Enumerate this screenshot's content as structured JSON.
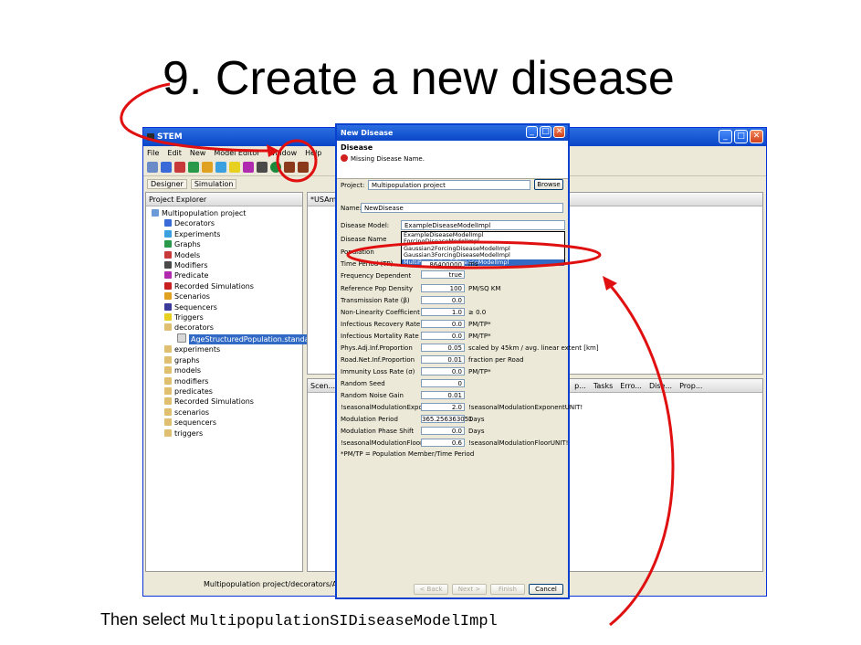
{
  "slide": {
    "title": "9. Create a new disease",
    "caption_prefix": "Then select ",
    "caption_code": "MultipopulationSIDiseaseModelImpl"
  },
  "stem_window": {
    "title": "STEM",
    "menu": [
      "File",
      "Edit",
      "New",
      "Model Editor",
      "Window",
      "Help"
    ],
    "perspectives": [
      "Designer",
      "Simulation"
    ],
    "project_explorer": {
      "title": "Project Explorer",
      "items": [
        "Multipopulation project",
        "Decorators",
        "Experiments",
        "Graphs",
        "Models",
        "Modifiers",
        "Predicate",
        "Recorded Simulations",
        "Scenarios",
        "Sequencers",
        "Triggers",
        "decorators",
        "AgeStructuredPopulation.standard",
        "experiments",
        "graphs",
        "models",
        "modifiers",
        "predicates",
        "Recorded Simulations",
        "scenarios",
        "sequencers",
        "triggers"
      ]
    },
    "editor_tab": "*USAm",
    "lower_panel_tab": "Scen...",
    "lower_tabs": [
      "p...",
      "Tasks",
      "Erro...",
      "Dise...",
      "Prop..."
    ],
    "status_text": "Multipopulation project/decorators/AgeStruct"
  },
  "dialog": {
    "title": "New Disease",
    "heading": "Disease",
    "message": "Missing Disease Name.",
    "project_label": "Project:",
    "project_value": "Multipopulation project",
    "browse": "Browse",
    "name_label": "Name:",
    "name_value": "NewDisease",
    "model_label": "Disease Model:",
    "model_value": "ExampleDiseaseModelImpl",
    "model_options": [
      "ExampleDiseaseModelImpl",
      "ForcingDiseaseModelImpl",
      "Gaussian2ForcingDiseaseModelImpl",
      "Gaussian3ForcingDiseaseModelImpl",
      "MultiPopulationSIDiseaseModelImpl"
    ],
    "disease_name_label": "Disease Name",
    "population_label": "Population",
    "time_period_label": "Time Period (TP)",
    "time_period_value": "86400000",
    "time_period_unit": "ms",
    "freq_label": "Frequency Dependent",
    "freq_value": "true",
    "params": [
      {
        "label": "Reference Pop Density",
        "value": "100",
        "unit": "PM/SQ KM"
      },
      {
        "label": "Transmission Rate (β)",
        "value": "0.0",
        "unit": ""
      },
      {
        "label": "Non-Linearity Coefficient",
        "value": "1.0",
        "unit": "≥ 0.0"
      },
      {
        "label": "Infectious Recovery Rate (γ)",
        "value": "0.0",
        "unit": "PM/TP*"
      },
      {
        "label": "Infectious Mortality Rate (μ i)",
        "value": "0.0",
        "unit": "PM/TP*"
      },
      {
        "label": "Phys.Adj.Inf.Proportion",
        "value": "0.05",
        "unit": "scaled by 45km / avg. linear extent [km]"
      },
      {
        "label": "Road.Net.Inf.Proportion",
        "value": "0.01",
        "unit": "fraction per Road"
      },
      {
        "label": "Immunity Loss Rate (σ)",
        "value": "0.0",
        "unit": "PM/TP*"
      },
      {
        "label": "Random Seed",
        "value": "0",
        "unit": ""
      },
      {
        "label": "Random Noise Gain",
        "value": "0.01",
        "unit": ""
      },
      {
        "label": "!seasonalModulationExponent!",
        "value": "2.0",
        "unit": "!seasonalModulationExponentUNIT!"
      },
      {
        "label": "Modulation Period",
        "value": "365.256363051",
        "unit": "Days"
      },
      {
        "label": "Modulation Phase Shift",
        "value": "0.0",
        "unit": "Days"
      },
      {
        "label": "!seasonalModulationFloor!",
        "value": "0.6",
        "unit": "!seasonalModulationFloorUNIT!"
      }
    ],
    "footnote": "*PM/TP = Population Member/Time Period",
    "buttons": {
      "back": "< Back",
      "next": "Next >",
      "finish": "Finish",
      "cancel": "Cancel"
    }
  },
  "colors": {
    "annotation": "#e01010",
    "selection": "#316ac5",
    "xp_blue": "#0a46c8"
  }
}
